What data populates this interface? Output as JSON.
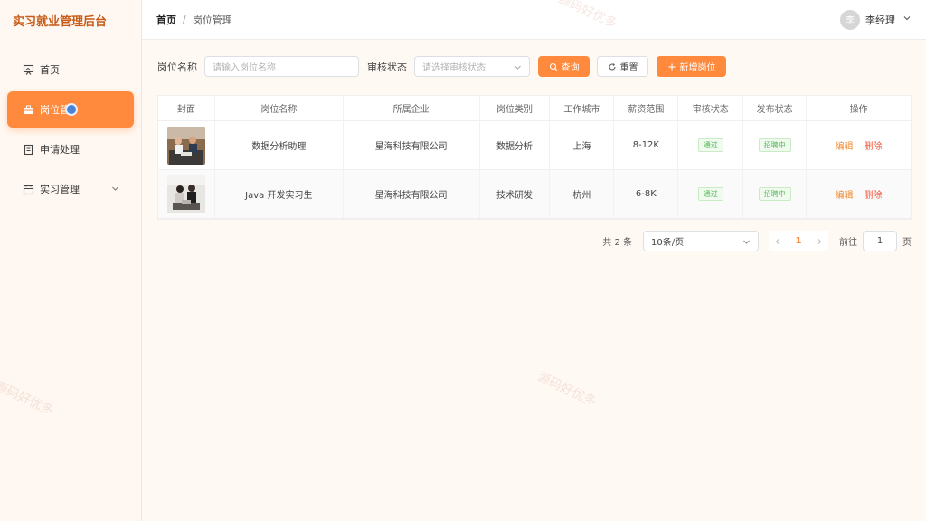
{
  "app": {
    "title": "实习就业管理后台"
  },
  "sidebar": {
    "items": [
      {
        "label": "首页",
        "icon": "home-board-icon"
      },
      {
        "label": "岗位管",
        "icon": "briefcase-icon"
      },
      {
        "label": "申请处理",
        "icon": "document-icon"
      },
      {
        "label": "实习管理",
        "icon": "calendar-icon"
      }
    ]
  },
  "header": {
    "breadcrumb": {
      "home": "首页",
      "separator": "/",
      "current": "岗位管理"
    },
    "user": {
      "avatar_text": "李",
      "name": "李经理"
    }
  },
  "filters": {
    "name_label": "岗位名称",
    "name_placeholder": "请输入岗位名称",
    "status_label": "审核状态",
    "status_placeholder": "请选择审核状态",
    "query_button": "查询",
    "reset_button": "重置",
    "add_button": "新增岗位"
  },
  "table": {
    "columns": [
      "封面",
      "岗位名称",
      "所属企业",
      "岗位类别",
      "工作城市",
      "薪资范围",
      "审核状态",
      "发布状态",
      "操作"
    ],
    "rows": [
      {
        "title": "数据分析助理",
        "company": "星海科技有限公司",
        "category": "数据分析",
        "city": "上海",
        "salary": "8-12K",
        "review": "通过",
        "publish": "招聘中",
        "edit": "编辑",
        "delete": "删除"
      },
      {
        "title": "Java 开发实习生",
        "company": "星海科技有限公司",
        "category": "技术研发",
        "city": "杭州",
        "salary": "6-8K",
        "review": "通过",
        "publish": "招聘中",
        "edit": "编辑",
        "delete": "删除"
      }
    ]
  },
  "pagination": {
    "total": "共 2 条",
    "page_size": "10条/页",
    "current_page": "1",
    "goto_prefix": "前往",
    "goto_value": "1",
    "goto_suffix": "页"
  },
  "watermark": "源码好优多",
  "colors": {
    "accent": "#ff8a3d",
    "success": "#52b95a",
    "danger": "#f0573e",
    "brand_text": "#c75a17"
  }
}
